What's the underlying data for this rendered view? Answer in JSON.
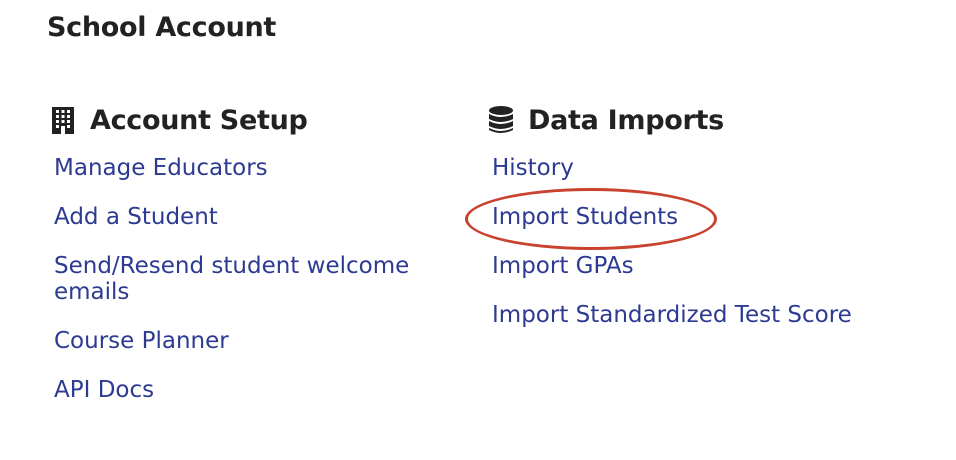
{
  "page": {
    "title": "School Account"
  },
  "account_setup": {
    "heading": "Account Setup",
    "icon": "building-icon",
    "links": [
      "Manage Educators",
      "Add a Student",
      "Send/Resend student welcome emails",
      "Course Planner",
      "API Docs"
    ]
  },
  "data_imports": {
    "heading": "Data Imports",
    "icon": "database-icon",
    "links": [
      "History",
      "Import Students",
      "Import GPAs",
      "Import Standardized Test Score"
    ],
    "highlighted_link": "Import Students"
  },
  "colors": {
    "link": "#2d3a92",
    "heading": "#222222",
    "highlight_circle": "#c8422e"
  }
}
